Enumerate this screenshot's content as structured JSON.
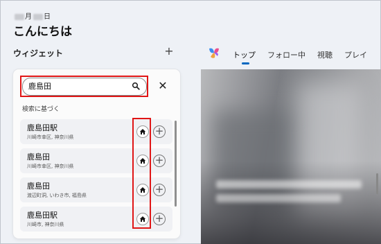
{
  "header": {
    "date_prefix": "",
    "date_month": "月",
    "date_day": "日",
    "greeting": "こんにちは"
  },
  "widgets": {
    "label": "ウィジェット",
    "add_label": "+"
  },
  "feed_tabs": [
    {
      "label": "トップ",
      "active": true
    },
    {
      "label": "フォロー中",
      "active": false
    },
    {
      "label": "視聴",
      "active": false
    },
    {
      "label": "プレイ",
      "active": false
    }
  ],
  "search": {
    "value": "鹿島田",
    "placeholder": "",
    "close_label": "✕",
    "section_label": "検索に基づく"
  },
  "results": [
    {
      "name": "鹿島田駅",
      "address": "川崎市幸区, 神奈川県"
    },
    {
      "name": "鹿島田",
      "address": "川崎市幸区, 神奈川県"
    },
    {
      "name": "鹿島田",
      "address": "渡辺町洞, いわき市, 福島県"
    },
    {
      "name": "鹿島田駅",
      "address": "川崎市, 神奈川県"
    }
  ],
  "colors": {
    "accent": "#0067c0",
    "highlight": "#e01515"
  }
}
